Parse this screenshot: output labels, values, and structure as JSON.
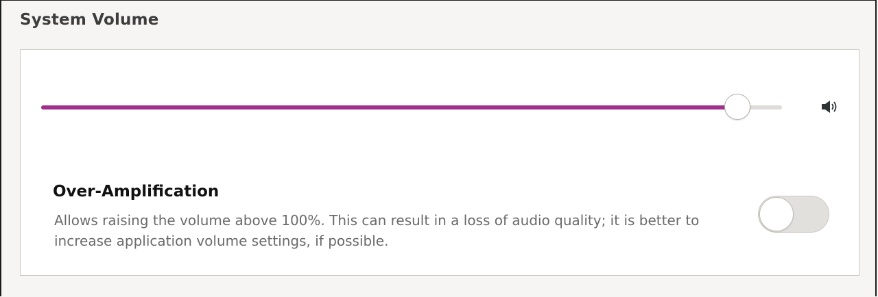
{
  "section": {
    "title": "System Volume"
  },
  "volume": {
    "level_fraction": 0.94,
    "accent_color": "#a12f8c",
    "icon": "speaker-volume-icon"
  },
  "over_amplification": {
    "title": "Over-Amplification",
    "description": "Allows raising the volume above 100%. This can result in a loss of audio quality; it is better to increase application volume settings, if possible.",
    "enabled": false
  }
}
